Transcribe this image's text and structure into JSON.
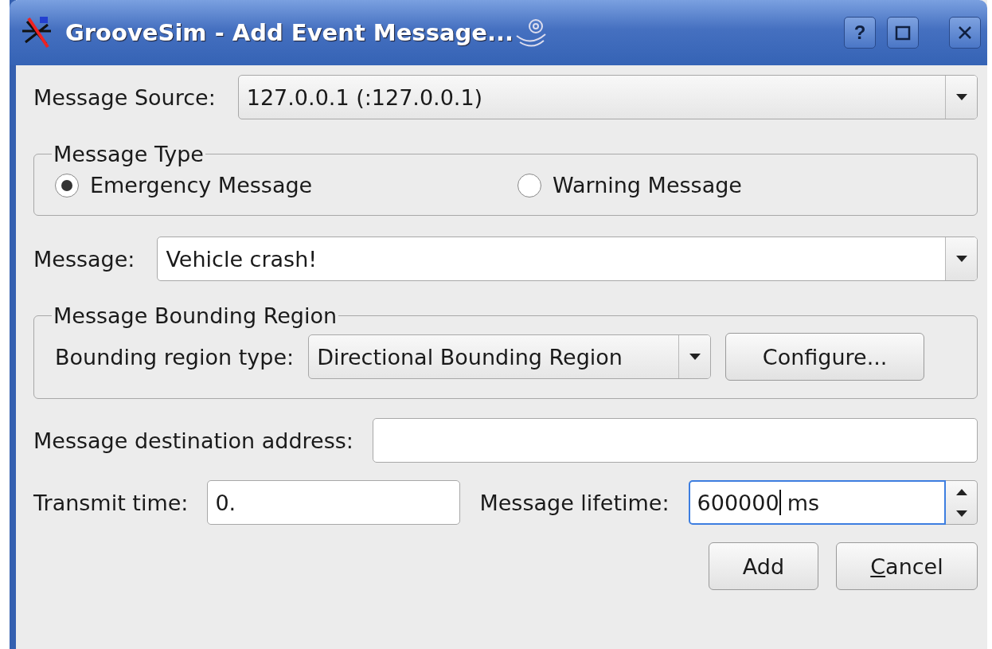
{
  "window": {
    "title": "GrooveSim - Add Event Message..."
  },
  "title_buttons": [
    {
      "kind": "help",
      "label": "?"
    },
    {
      "kind": "maximize"
    },
    {
      "kind": "close"
    }
  ],
  "message_source": {
    "label": "Message Source:",
    "value": "127.0.0.1 (:127.0.0.1)"
  },
  "message_type": {
    "title": "Message Type",
    "options": [
      {
        "label": "Emergency Message",
        "selected": true
      },
      {
        "label": "Warning Message",
        "selected": false
      }
    ]
  },
  "message": {
    "label": "Message:",
    "value": "Vehicle crash!"
  },
  "bounding_region": {
    "title": "Message Bounding Region",
    "type_label": "Bounding region type:",
    "type_value": "Directional Bounding Region",
    "configure": "Configure..."
  },
  "destination": {
    "label": "Message destination address:"
  },
  "transmit_time": {
    "label": "Transmit time:",
    "value": "0."
  },
  "lifetime": {
    "label": "Message lifetime:",
    "value": "600000",
    "suffix": " ms",
    "focused": true
  },
  "buttons": [
    {
      "label": "Add",
      "underline_first": false
    },
    {
      "label": "Cancel",
      "underline_first": true
    }
  ]
}
